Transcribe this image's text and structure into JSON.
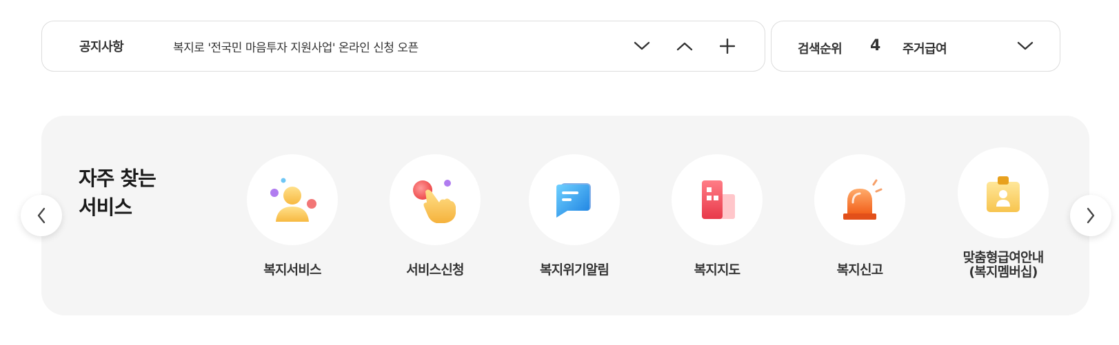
{
  "notice": {
    "label": "공지사항",
    "text": "복지로 '전국민 마음투자 지원사업' 온라인 신청 오픈"
  },
  "search_rank": {
    "label": "검색순위",
    "rank": "4",
    "term": "주거급여"
  },
  "services": {
    "title": "자주 찾는\n서비스",
    "items": [
      {
        "label": "복지서비스",
        "icon": "people-icon"
      },
      {
        "label": "서비스신청",
        "icon": "hand-pointer-icon"
      },
      {
        "label": "복지위기알림",
        "icon": "message-icon"
      },
      {
        "label": "복지지도",
        "icon": "map-building-icon"
      },
      {
        "label": "복지신고",
        "icon": "siren-icon"
      },
      {
        "label": "맞춤형급여안내\n(복지멤버십)",
        "icon": "id-card-icon"
      }
    ]
  },
  "colors": {
    "panel_bg": "#f5f5f5",
    "border": "#dcdcdc",
    "text": "#333333"
  }
}
